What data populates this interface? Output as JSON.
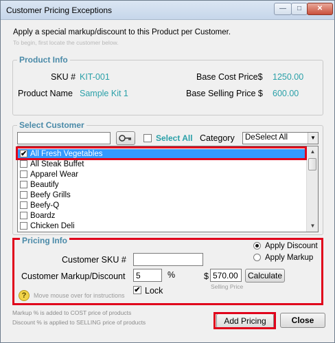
{
  "window": {
    "title": "Customer Pricing Exceptions",
    "minimize": "—",
    "maximize": "□",
    "close": "✕"
  },
  "intro": {
    "line1": "Apply a special markup/discount to this Product per Customer.",
    "line2": "To begin, first locate the customer below."
  },
  "product_info": {
    "title": "Product Info",
    "sku_label": "SKU #",
    "sku_value": "KIT-001",
    "name_label": "Product Name",
    "name_value": "Sample Kit 1",
    "cost_label": "Base Cost Price$",
    "cost_value": "1250.00",
    "selling_label": "Base Selling Price $",
    "selling_value": "600.00"
  },
  "select_customer": {
    "title": "Select Customer",
    "search_value": "",
    "select_all_label": "Select All",
    "category_label": "Category",
    "category_value": "DeSelect All",
    "customers": [
      {
        "name": "All Fresh Vegetables",
        "checked": true,
        "selected": true
      },
      {
        "name": "All Steak Buffet",
        "checked": false,
        "selected": false
      },
      {
        "name": "Apparel Wear",
        "checked": false,
        "selected": false
      },
      {
        "name": "Beautify",
        "checked": false,
        "selected": false
      },
      {
        "name": "Beefy Grills",
        "checked": false,
        "selected": false
      },
      {
        "name": "Beefy-Q",
        "checked": false,
        "selected": false
      },
      {
        "name": "Boardz",
        "checked": false,
        "selected": false
      },
      {
        "name": "Chicken Deli",
        "checked": false,
        "selected": false
      }
    ]
  },
  "pricing_info": {
    "title": "Pricing Info",
    "apply_discount_label": "Apply Discount",
    "apply_markup_label": "Apply Markup",
    "apply_discount_selected": true,
    "customer_sku_label": "Customer SKU #",
    "customer_sku_value": "",
    "markup_label": "Customer Markup/Discount",
    "markup_value": "5",
    "percent_sign": "%",
    "dollar_sign": "$",
    "price_value": "570.00",
    "calculate_label": "Calculate",
    "selling_price_caption": "Selling Price",
    "lock_label": "Lock",
    "lock_checked": true,
    "help_text": "Move mouse over for instructions",
    "help_glyph": "?"
  },
  "footer": {
    "note1": "Markup % is added to COST price of products",
    "note2": "Discount % is applied to SELLING price of products",
    "add_pricing_label": "Add Pricing",
    "close_label": "Close"
  },
  "colors": {
    "accent_text": "#2aa0a8",
    "group_title": "#4a8aa8",
    "highlight_border": "#e0001b",
    "selection": "#3399ff"
  }
}
